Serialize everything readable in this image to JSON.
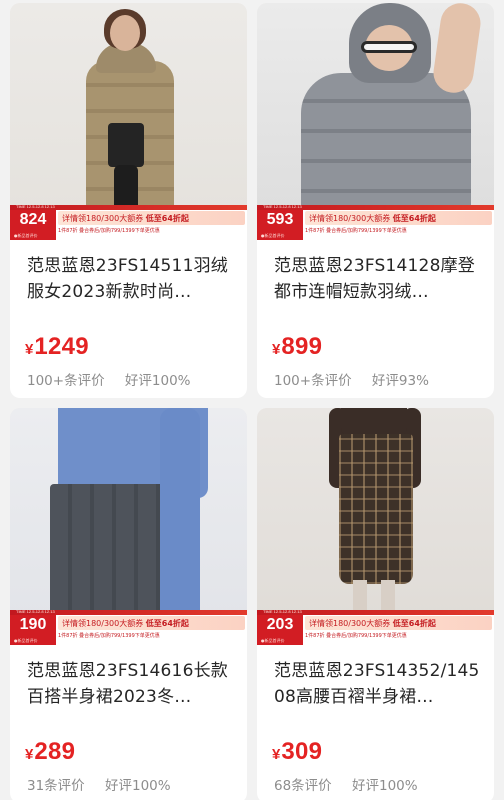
{
  "products": [
    {
      "title": "范思蓝恩23FS14511羽绒服女2023新款时尚…",
      "currency": "¥",
      "price": "1249",
      "reviews": "100+条评价",
      "good_rate": "好评100%",
      "promo_price": "824",
      "promo_text_a": "详情领180/300大额券 ",
      "promo_text_b": "低至64折起",
      "promo_subtext": "1件87折 叠合券后/加购799/1399下单更优惠",
      "promo_caption": "●新品首评价",
      "promo_top": "TIME 12.5-12.8 12.13"
    },
    {
      "title": "范思蓝恩23FS14128摩登都市连帽短款羽绒…",
      "currency": "¥",
      "price": "899",
      "reviews": "100+条评价",
      "good_rate": "好评93%",
      "promo_price": "593",
      "promo_text_a": "详情领180/300大额券 ",
      "promo_text_b": "低至64折起",
      "promo_subtext": "1件87折 叠合券后/加购799/1399下单更优惠",
      "promo_caption": "●新品首评价",
      "promo_top": "TIME 12.5-12.8 12.13"
    },
    {
      "title": "范思蓝恩23FS14616长款百搭半身裙2023冬…",
      "currency": "¥",
      "price": "289",
      "reviews": "31条评价",
      "good_rate": "好评100%",
      "promo_price": "190",
      "promo_text_a": "详情领180/300大额券 ",
      "promo_text_b": "低至64折起",
      "promo_subtext": "1件87折 叠合券后/加购799/1399下单更优惠",
      "promo_caption": "●新品首评价",
      "promo_top": "TIME 12.5-12.8 12.13"
    },
    {
      "title": "范思蓝恩23FS14352/14508高腰百褶半身裙…",
      "currency": "¥",
      "price": "309",
      "reviews": "68条评价",
      "good_rate": "好评100%",
      "promo_price": "203",
      "promo_text_a": "详情领180/300大额券 ",
      "promo_text_b": "低至64折起",
      "promo_subtext": "1件87折 叠合券后/加购799/1399下单更优惠",
      "promo_caption": "●新品首评价",
      "promo_top": "TIME 12.5-12.8 12.13"
    }
  ],
  "colors": {
    "price_red": "#e42323",
    "promo_red": "#d21d23",
    "muted_gray": "#8d8d8d",
    "background": "#f2f2f2"
  }
}
